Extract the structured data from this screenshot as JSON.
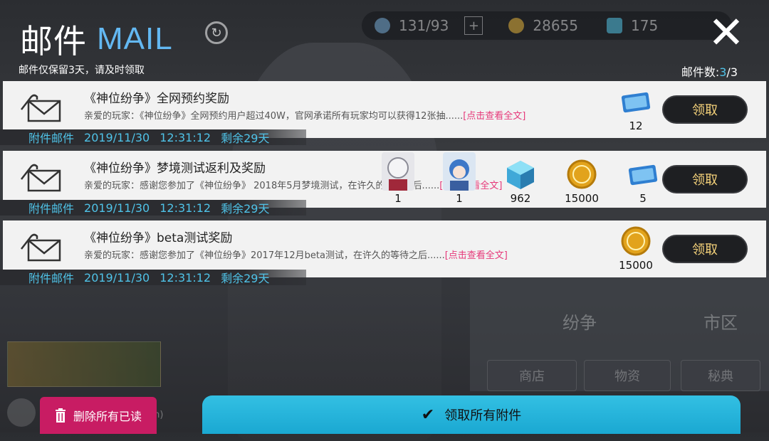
{
  "header": {
    "title_cn": "邮件",
    "title_en": "MAIL",
    "notice": "邮件仅保留3天，请及时领取",
    "count_label": "邮件数:",
    "count_current": "3",
    "count_total": "/3"
  },
  "resources": [
    {
      "name": "stamina",
      "value": "131/93"
    },
    {
      "name": "gold",
      "value": "28655"
    },
    {
      "name": "crystal",
      "value": "175"
    }
  ],
  "mails": [
    {
      "title": "《神位纷争》全网预约奖励",
      "desc": "亲爱的玩家：《神位纷争》全网预约用户超过40W，官网承诺所有玩家均可以获得12张抽......",
      "more": "[点击查看全文]",
      "meta": {
        "tag": "附件邮件",
        "date": "2019/11/30",
        "time": "12:31:12",
        "remain": "剩余29天"
      },
      "rewards": [
        {
          "icon": "ticket-icon",
          "qty": "12"
        }
      ],
      "claim": "领取"
    },
    {
      "title": "《神位纷争》梦境测试返利及奖励",
      "desc": "亲爱的玩家：感谢您参加了《神位纷争》 2018年5月梦境测试，在许久的等待之后......",
      "more": "[点击查看全文]",
      "meta": {
        "tag": "附件邮件",
        "date": "2019/11/30",
        "time": "12:31:12",
        "remain": "剩余29天"
      },
      "rewards": [
        {
          "icon": "avatar-white-hair",
          "qty": "1"
        },
        {
          "icon": "avatar-blue-hair",
          "qty": "1"
        },
        {
          "icon": "crystal-icon",
          "qty": "962"
        },
        {
          "icon": "gold-coin-icon",
          "qty": "15000"
        },
        {
          "icon": "ticket-icon",
          "qty": "5"
        }
      ],
      "claim": "领取"
    },
    {
      "title": "《神位纷争》beta测试奖励",
      "desc": "亲爱的玩家：感谢您参加了《神位纷争》2017年12月beta测试，在许久的等待之后......",
      "more": "[点击查看全文]",
      "meta": {
        "tag": "附件邮件",
        "date": "2019/11/30",
        "time": "12:31:12",
        "remain": "剩余29天"
      },
      "rewards": [
        {
          "icon": "gold-coin-icon",
          "qty": "15000"
        }
      ],
      "claim": "领取"
    }
  ],
  "background": {
    "tiles": [
      "商店",
      "物资",
      "秘典"
    ],
    "labels": [
      "纷争",
      "市区"
    ],
    "chat_hint": "一块、cn)"
  },
  "footer": {
    "delete_all": "删除所有已读",
    "claim_all": "领取所有附件"
  },
  "colors": {
    "accent": "#4fc3e8",
    "claim_all_bg": "#1aa8d2",
    "delete_bg": "#c81c63",
    "link": "#e6397a",
    "claim_text": "#f5d27a"
  }
}
